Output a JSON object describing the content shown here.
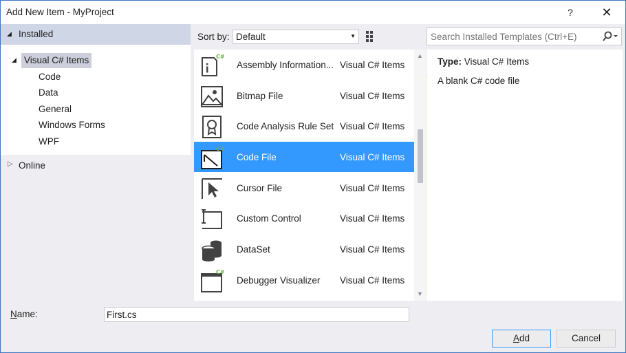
{
  "window": {
    "title": "Add New Item - MyProject",
    "help": "?",
    "close": "✕"
  },
  "tree": {
    "installed": "Installed",
    "root": "Visual C# Items",
    "children": [
      "Code",
      "Data",
      "General",
      "Windows Forms",
      "WPF"
    ],
    "online": "Online"
  },
  "toolbar": {
    "sort_label": "Sort by:",
    "sort_value": "Default",
    "search_placeholder": "Search Installed Templates (Ctrl+E)"
  },
  "items": [
    {
      "name": "Assembly Information...",
      "category": "Visual C# Items",
      "icon": "assembly-info-icon"
    },
    {
      "name": "Bitmap File",
      "category": "Visual C# Items",
      "icon": "bitmap-icon"
    },
    {
      "name": "Code Analysis Rule Set",
      "category": "Visual C# Items",
      "icon": "ruleset-icon"
    },
    {
      "name": "Code File",
      "category": "Visual C# Items",
      "icon": "code-file-icon",
      "selected": true
    },
    {
      "name": "Cursor File",
      "category": "Visual C# Items",
      "icon": "cursor-icon"
    },
    {
      "name": "Custom Control",
      "category": "Visual C# Items",
      "icon": "custom-control-icon"
    },
    {
      "name": "DataSet",
      "category": "Visual C# Items",
      "icon": "dataset-icon"
    },
    {
      "name": "Debugger Visualizer",
      "category": "Visual C# Items",
      "icon": "debugger-visualizer-icon"
    }
  ],
  "details": {
    "type_label": "Type:",
    "type_value": "Visual C# Items",
    "description": "A blank C# code file"
  },
  "footer": {
    "name_label_accel": "N",
    "name_label_rest": "ame:",
    "name_value": "First.cs",
    "add_accel": "A",
    "add_rest": "dd",
    "cancel": "Cancel"
  },
  "colors": {
    "accent": "#3399ff",
    "frame": "#3c76c0",
    "csharp_badge": "#68b244"
  }
}
